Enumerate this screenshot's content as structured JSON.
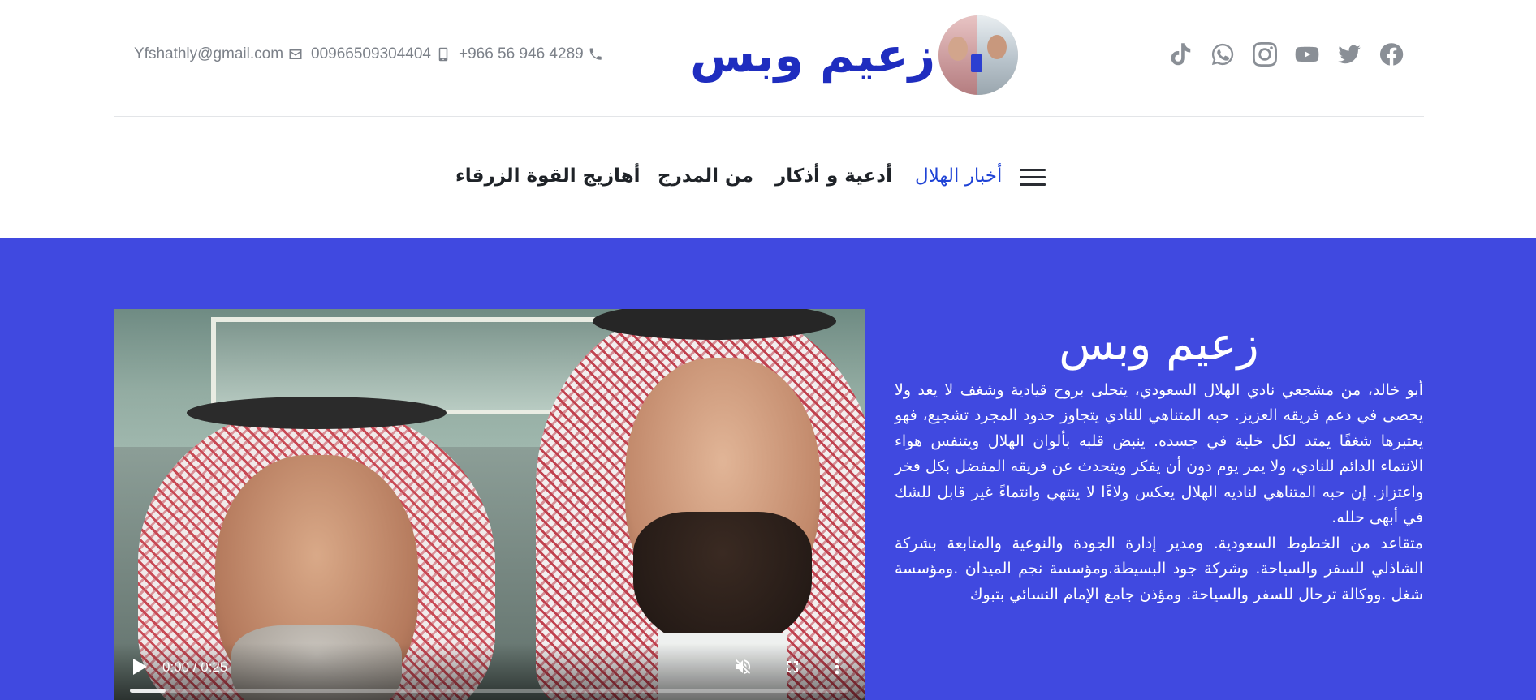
{
  "header": {
    "social": [
      {
        "name": "facebook",
        "icon": "facebook-icon"
      },
      {
        "name": "twitter",
        "icon": "twitter-icon"
      },
      {
        "name": "youtube",
        "icon": "youtube-icon"
      },
      {
        "name": "instagram",
        "icon": "instagram-icon"
      },
      {
        "name": "whatsapp",
        "icon": "whatsapp-icon"
      },
      {
        "name": "tiktok",
        "icon": "tiktok-icon"
      }
    ],
    "brand_title": "زعيم وبس",
    "contact": {
      "email": "Yfshathly@gmail.com",
      "mobile": "00966509304404",
      "phone": "+966 56 946 4289"
    }
  },
  "nav": {
    "items": [
      {
        "label": "أخبار الهلال",
        "active": true
      },
      {
        "label": "أدعية و أذكار",
        "active": false
      },
      {
        "label": "من المدرج",
        "active": false
      },
      {
        "label": "أهازيج القوة الزرقاء",
        "active": false
      }
    ]
  },
  "hero": {
    "video": {
      "time": "0:00 / 0:25",
      "progress": 0.05
    },
    "title": "زعيم وبس",
    "paragraphs": [
      "أبو خالد، من  مشجعي نادي الهلال السعودي، يتحلى بروح قيادية وشغف لا يعد ولا يحصى في دعم فريقه العزيز. حبه المتناهي للنادي يتجاوز حدود المجرد تشجيع، فهو يعتبرها شغفًا يمتد لكل خلية في جسده. ينبض قلبه بألوان الهلال  ويتنفس هواء الانتماء الدائم للنادي، ولا يمر يوم دون أن يفكر ويتحدث عن فريقه المفضل بكل فخر واعتزاز. إن حبه المتناهي لناديه  الهلال  يعكس ولاءًا لا ينتهي وانتماءً غير قابل للشك في أبهى حلله.",
      "متقاعد من الخطوط السعودية. ومدير إدارة الجودة والنوعية والمتابعة بشركة الشاذلي للسفر والسياحة. وشركة جود البسيطة.ومؤسسة نجم الميدان .ومؤسسة شغل .ووكالة ترحال للسفر والسياحة. ومؤذن جامع الإمام النسائي بتبوك"
    ]
  },
  "colors": {
    "brand": "#1f2dbf",
    "nav_active": "#1f43d6",
    "hero_bg": "#4049e0",
    "icon_gray": "#8a8f96"
  }
}
